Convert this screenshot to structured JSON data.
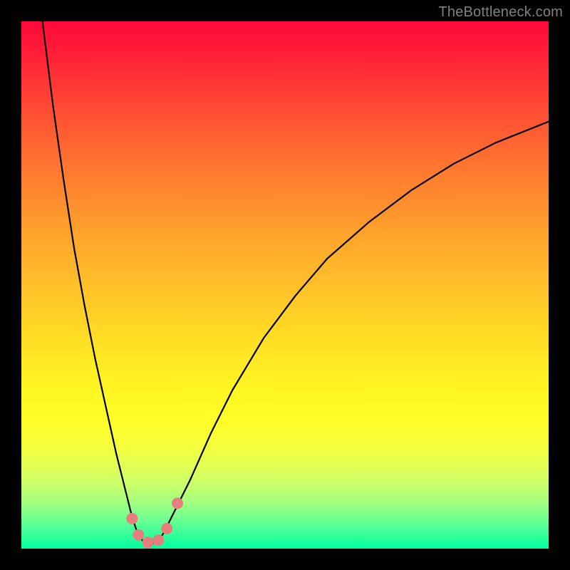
{
  "watermark": "TheBottleneck.com",
  "chart_data": {
    "type": "line",
    "title": "",
    "xlabel": "",
    "ylabel": "",
    "xlim": [
      0,
      100
    ],
    "ylim": [
      0,
      100
    ],
    "grid": false,
    "legend": false,
    "series": [
      {
        "name": "bottleneck-curve",
        "stroke": "#000000",
        "x": [
          4,
          6,
          8,
          10,
          12,
          14,
          16,
          18,
          20,
          21,
          22,
          23,
          24,
          25,
          26,
          27,
          29,
          32,
          36,
          40,
          46,
          52,
          58,
          66,
          74,
          82,
          90,
          100
        ],
        "values": [
          100,
          84,
          70,
          57,
          46,
          36,
          27,
          18,
          10,
          6,
          3,
          1.5,
          1,
          1,
          1.5,
          3,
          7,
          13,
          22,
          30,
          40,
          48,
          55,
          62,
          68,
          73,
          77,
          81
        ]
      }
    ],
    "markers": [
      {
        "x": 21.0,
        "y": 5.7,
        "r": 8,
        "fill": "#e77d7c"
      },
      {
        "x": 22.2,
        "y": 2.6,
        "r": 8,
        "fill": "#e77d7c"
      },
      {
        "x": 24.0,
        "y": 1.2,
        "r": 8,
        "fill": "#e77d7c"
      },
      {
        "x": 26.0,
        "y": 1.6,
        "r": 8,
        "fill": "#e77d7c"
      },
      {
        "x": 27.6,
        "y": 3.8,
        "r": 8,
        "fill": "#e77d7c"
      },
      {
        "x": 29.6,
        "y": 8.6,
        "r": 8,
        "fill": "#e77d7c"
      }
    ]
  },
  "colors": {
    "frame": "#000000",
    "gradient_top": "#ff083a",
    "gradient_mid": "#fff622",
    "gradient_bottom": "#00ffa0",
    "curve": "#000000",
    "marker": "#e77d7c",
    "watermark": "#808080"
  }
}
